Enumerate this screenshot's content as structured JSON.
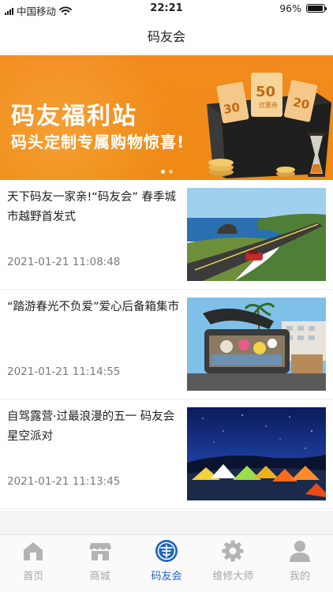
{
  "status_bar": {
    "carrier": "中国移动",
    "time": "22:21",
    "battery_text": "96%",
    "battery_level": 0.96
  },
  "header": {
    "title": "码友会"
  },
  "banner": {
    "line1": "码友福利站",
    "line2": "码头定制专属购物惊喜!",
    "slide_count": 2,
    "active_slide": 1,
    "coupon_values": [
      "30",
      "50",
      "20"
    ],
    "coupon_label": "优惠券"
  },
  "articles": [
    {
      "title": "天下码友一家亲!“码友会” 春季城市越野首发式",
      "time": "2021-01-21 11:08:48",
      "thumb_icon": "coastal-road-car-image"
    },
    {
      "title": "“踏游春光不负爱”爱心后备箱集市",
      "time": "2021-01-21 11:14:55",
      "thumb_icon": "car-trunk-market-image"
    },
    {
      "title": "自驾露营·过最浪漫的五一 码友会星空派对",
      "time": "2021-01-21 11:13:45",
      "thumb_icon": "starry-camping-tents-image"
    }
  ],
  "tabs": [
    {
      "label": "首页",
      "icon": "home-icon",
      "active": false
    },
    {
      "label": "商城",
      "icon": "store-icon",
      "active": false
    },
    {
      "label": "码友会",
      "icon": "club-icon",
      "active": true
    },
    {
      "label": "维修大师",
      "icon": "gear-icon",
      "active": false
    },
    {
      "label": "我的",
      "icon": "profile-icon",
      "active": false
    }
  ],
  "colors": {
    "accent": "#1f62c0",
    "banner_orange": "#ef8a14",
    "tab_inactive": "#a8a8a8"
  }
}
